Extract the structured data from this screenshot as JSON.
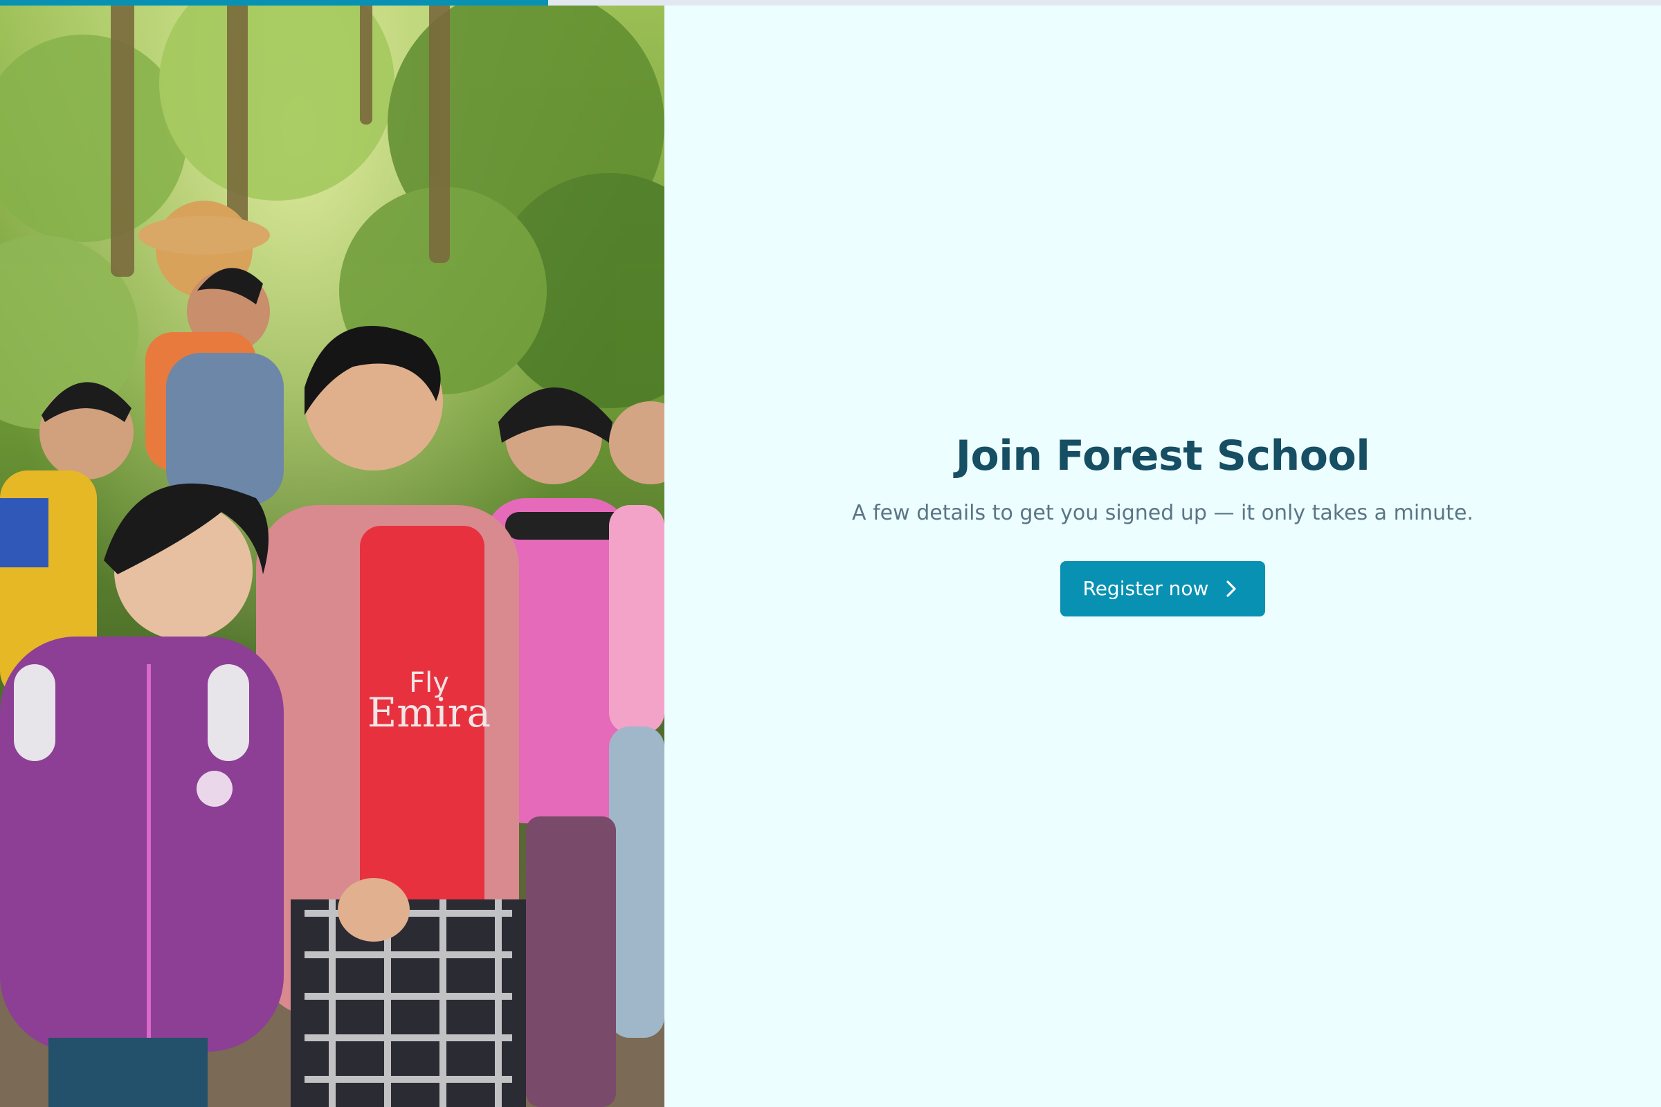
{
  "progress": {
    "fraction": 0.33,
    "fill_color": "#0891b2",
    "track_color": "#e2e8f0"
  },
  "hero_image": {
    "icon": "photo-children-walking-in-forest"
  },
  "main": {
    "title": "Join Forest School",
    "subtitle": "A few details to get you signed up — it only takes a minute.",
    "register_button": {
      "label": "Register now",
      "icon": "chevron-right-icon"
    }
  },
  "colors": {
    "accent": "#0891b2",
    "title": "#164e63",
    "subtitle": "#5b7585",
    "background": "#ecfeff"
  }
}
